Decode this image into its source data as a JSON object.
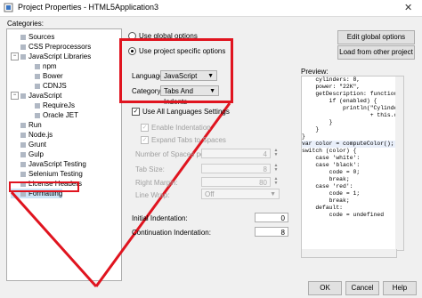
{
  "window": {
    "title": "Project Properties - HTML5Application3",
    "close_glyph": "✕"
  },
  "categories_label": "Categories:",
  "tree": [
    {
      "label": "Sources",
      "indent": 1,
      "expander": ""
    },
    {
      "label": "CSS Preprocessors",
      "indent": 1,
      "expander": ""
    },
    {
      "label": "JavaScript Libraries",
      "indent": 1,
      "expander": "−"
    },
    {
      "label": "npm",
      "indent": 2,
      "expander": ""
    },
    {
      "label": "Bower",
      "indent": 2,
      "expander": ""
    },
    {
      "label": "CDNJS",
      "indent": 2,
      "expander": ""
    },
    {
      "label": "JavaScript",
      "indent": 1,
      "expander": "−"
    },
    {
      "label": "RequireJs",
      "indent": 2,
      "expander": ""
    },
    {
      "label": "Oracle JET",
      "indent": 2,
      "expander": ""
    },
    {
      "label": "Run",
      "indent": 1,
      "expander": ""
    },
    {
      "label": "Node.js",
      "indent": 1,
      "expander": ""
    },
    {
      "label": "Grunt",
      "indent": 1,
      "expander": ""
    },
    {
      "label": "Gulp",
      "indent": 1,
      "expander": ""
    },
    {
      "label": "JavaScript Testing",
      "indent": 1,
      "expander": ""
    },
    {
      "label": "Selenium Testing",
      "indent": 1,
      "expander": ""
    },
    {
      "label": "License Headers",
      "indent": 1,
      "expander": ""
    },
    {
      "label": "Formatting",
      "indent": 1,
      "expander": "",
      "selected": true
    }
  ],
  "options": {
    "use_global": "Use global options",
    "use_project": "Use project specific options",
    "edit_global": "Edit global options",
    "load_other": "Load from other project"
  },
  "language": {
    "label": "Language:",
    "value": "JavaScript"
  },
  "category": {
    "label": "Category:",
    "value": "Tabs And Indents"
  },
  "use_all_languages": "Use All Languages Settings",
  "enable_indentation": "Enable Indentation",
  "expand_tabs": "Expand Tabs to Spaces",
  "spaces_per_indent": {
    "label": "Number of Spaces per Indent:",
    "value": "4"
  },
  "tab_size": {
    "label": "Tab Size:",
    "value": "8"
  },
  "right_margin": {
    "label": "Right Margin:",
    "value": "80"
  },
  "line_wrap": {
    "label": "Line Wrap:",
    "value": "Off"
  },
  "initial_indentation": {
    "label": "Initial Indentation:",
    "value": "0"
  },
  "continuation_indentation": {
    "label": "Continuation Indentation:",
    "value": "8"
  },
  "preview_label": "Preview:",
  "preview_lines": [
    "    cylinders: 8,",
    "    power: \"22K\",",
    "    getDescription: function ()",
    "        if (enabled) {",
    "            println(\"Cylinders:",
    "                    + this.cylin",
    "        }",
    "    }",
    "}",
    "var color = computeColor();",
    "switch (color) {",
    "    case 'white':",
    "    case 'black':",
    "        code = 0;",
    "        break;",
    "    case 'red':",
    "        code = 1;",
    "        break;",
    "    default:",
    "        code = undefined"
  ],
  "buttons": {
    "ok": "OK",
    "cancel": "Cancel",
    "help": "Help"
  },
  "colors": {
    "annotation_red": "#e0141f",
    "selection": "#cce4f7"
  }
}
